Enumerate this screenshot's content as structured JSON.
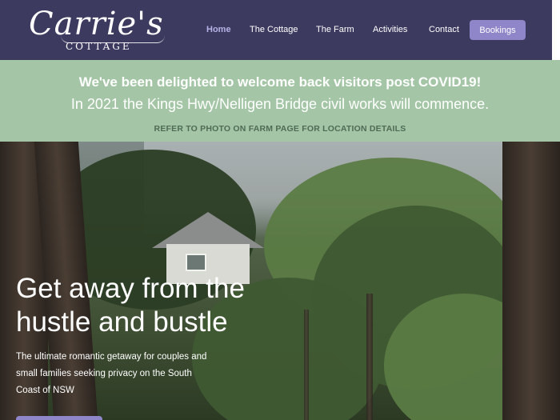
{
  "brand": {
    "logo_script": "Carrie's",
    "logo_sub": "COTTAGE"
  },
  "nav": {
    "items": [
      {
        "label": "Home",
        "active": true
      },
      {
        "label": "The Cottage",
        "active": false
      },
      {
        "label": "The Farm",
        "active": false
      },
      {
        "label": "Activities",
        "active": false
      },
      {
        "label": "Contact",
        "active": false
      }
    ],
    "bookings_label": "Bookings"
  },
  "notice": {
    "heading": "We've been delighted to welcome back visitors post COVID19!",
    "subheading": "In 2021 the Kings Hwy/Nelligen Bridge civil works will commence.",
    "link": "REFER TO PHOTO ON FARM PAGE FOR LOCATION DETAILS"
  },
  "hero": {
    "title_line1": "Get away from the",
    "title_line2": "hustle and bustle",
    "description": "The ultimate romantic getaway for couples and small families seeking privacy on the South Coast of NSW"
  },
  "colors": {
    "header_bg": "#3c3a5f",
    "accent": "#8f86c9",
    "notice_bg": "#a4c6a6",
    "nav_active": "#b6b2e6"
  }
}
